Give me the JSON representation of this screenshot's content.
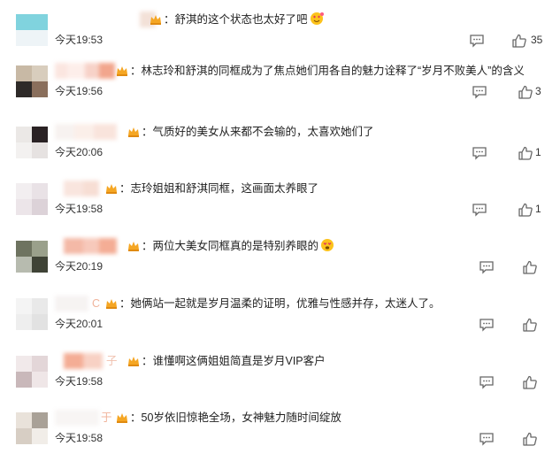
{
  "comments": [
    {
      "text": "：舒淇的这个状态也太好了吧",
      "emoji": "love-face",
      "time": "今天19:53",
      "likes": "35"
    },
    {
      "text": "：林志玲和舒淇的同框成为了焦点她们用各自的魅力诠释了“岁月不败美人”的含义",
      "emoji": "",
      "time": "今天19:56",
      "likes": "3"
    },
    {
      "text": "：气质好的美女从来都不会输的，太喜欢她们了",
      "emoji": "",
      "time": "今天20:06",
      "likes": "1"
    },
    {
      "text": "：志玲姐姐和舒淇同框，这画面太养眼了",
      "emoji": "",
      "time": "今天19:58",
      "likes": "1"
    },
    {
      "text": "：两位大美女同框真的是特别养眼的",
      "emoji": "heart-eyes-face",
      "time": "今天20:19",
      "likes": ""
    },
    {
      "text": "：她俩站一起就是岁月温柔的证明，优雅与性感并存，太迷人了。",
      "emoji": "",
      "time": "今天20:01",
      "likes": ""
    },
    {
      "text": "：谁懂啊这俩姐姐简直是岁月VIP客户",
      "emoji": "",
      "time": "今天19:58",
      "likes": ""
    },
    {
      "text": "：50岁依旧惊艳全场，女神魅力随时间绽放",
      "emoji": "",
      "time": "今天19:58",
      "likes": ""
    }
  ],
  "partial_name_chars": [
    "C",
    "子",
    "于"
  ],
  "colors": {
    "crown": "#f5a623",
    "icon": "#666666",
    "text": "#222222"
  }
}
